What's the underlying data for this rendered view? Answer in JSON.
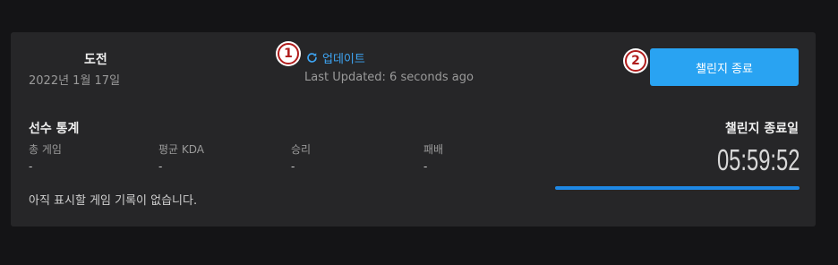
{
  "challenge": {
    "title": "도전",
    "date": "2022년 1월 17일"
  },
  "update": {
    "label": "업데이트",
    "last_updated": "Last Updated: 6 seconds ago",
    "icon": "refresh-icon"
  },
  "annotations": {
    "badge1": "1",
    "badge2": "2"
  },
  "end_button": {
    "label": "챌린지 종료"
  },
  "player_stats": {
    "title": "선수 통계",
    "columns": [
      {
        "label": "총 게임",
        "value": "-"
      },
      {
        "label": "평균 KDA",
        "value": "-"
      },
      {
        "label": "승리",
        "value": "-"
      },
      {
        "label": "패배",
        "value": "-"
      }
    ],
    "empty_message": "아직 표시할 게임 기록이 없습니다."
  },
  "end_date": {
    "label": "챌린지 종료일",
    "countdown": "05:59:52",
    "progress_fraction": 1.0
  },
  "colors": {
    "accent": "#29a3f2",
    "link": "#3ea6f5",
    "progress": "#1e88e5",
    "badge_border": "#b01c1c"
  }
}
